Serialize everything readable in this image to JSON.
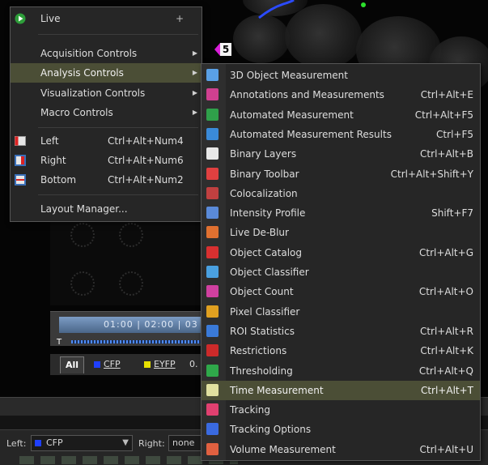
{
  "main_menu": {
    "items": [
      {
        "label": "Live",
        "type": "add",
        "suffix": "+"
      },
      {
        "label": "Acquisition Controls",
        "type": "submenu"
      },
      {
        "label": "Analysis Controls",
        "type": "submenu",
        "highlighted": true
      },
      {
        "label": "Visualization Controls",
        "type": "submenu"
      },
      {
        "label": "Macro Controls",
        "type": "submenu"
      },
      {
        "label": "Left",
        "shortcut": "Ctrl+Alt+Num4"
      },
      {
        "label": "Right",
        "shortcut": "Ctrl+Alt+Num6"
      },
      {
        "label": "Bottom",
        "shortcut": "Ctrl+Alt+Num2"
      },
      {
        "label": "Layout Manager..."
      }
    ]
  },
  "submenu": {
    "items": [
      {
        "label": "3D Object Measurement",
        "shortcut": "",
        "icon": "3d-object-icon"
      },
      {
        "label": "Annotations and Measurements",
        "shortcut": "Ctrl+Alt+E",
        "icon": "annotations-icon"
      },
      {
        "label": "Automated Measurement",
        "shortcut": "Ctrl+Alt+F5",
        "icon": "automated-measurement-icon"
      },
      {
        "label": "Automated Measurement Results",
        "shortcut": "Ctrl+F5",
        "icon": "measurement-results-icon"
      },
      {
        "label": "Binary Layers",
        "shortcut": "Ctrl+Alt+B",
        "icon": "binary-layers-icon"
      },
      {
        "label": "Binary Toolbar",
        "shortcut": "Ctrl+Alt+Shift+Y",
        "icon": "binary-toolbar-icon"
      },
      {
        "label": "Colocalization",
        "shortcut": "",
        "icon": "colocalization-icon"
      },
      {
        "label": "Intensity Profile",
        "shortcut": "Shift+F7",
        "icon": "intensity-profile-icon"
      },
      {
        "label": "Live De-Blur",
        "shortcut": "",
        "icon": "deblur-icon"
      },
      {
        "label": "Object Catalog",
        "shortcut": "Ctrl+Alt+G",
        "icon": "object-catalog-icon"
      },
      {
        "label": "Object Classifier",
        "shortcut": "",
        "icon": "object-classifier-icon"
      },
      {
        "label": "Object Count",
        "shortcut": "Ctrl+Alt+O",
        "icon": "object-count-icon"
      },
      {
        "label": "Pixel Classifier",
        "shortcut": "",
        "icon": "pixel-classifier-icon"
      },
      {
        "label": "ROI Statistics",
        "shortcut": "Ctrl+Alt+R",
        "icon": "roi-statistics-icon"
      },
      {
        "label": "Restrictions",
        "shortcut": "Ctrl+Alt+K",
        "icon": "restrictions-icon"
      },
      {
        "label": "Thresholding",
        "shortcut": "Ctrl+Alt+Q",
        "icon": "thresholding-icon"
      },
      {
        "label": "Time Measurement",
        "shortcut": "Ctrl+Alt+T",
        "icon": "clock-icon",
        "highlighted": true
      },
      {
        "label": "Tracking",
        "shortcut": "",
        "icon": "tracking-icon"
      },
      {
        "label": "Tracking Options",
        "shortcut": "",
        "icon": "tracking-options-icon"
      },
      {
        "label": "Volume Measurement",
        "shortcut": "Ctrl+Alt+U",
        "icon": "volume-icon"
      }
    ]
  },
  "background": {
    "object_tag": "5",
    "timeline_text": "01:00 | 02:00 | 03",
    "t_label": "T",
    "tabs": {
      "all": "All",
      "cfp": "CFP",
      "eyfp": "EYFP",
      "zoom": "0."
    },
    "bottom": {
      "left_label": "Left:",
      "left_value": "CFP",
      "right_label": "Right:",
      "right_value": "none"
    }
  },
  "colors": {
    "highlight": "#4b4e36",
    "cfp": "#1f3fff",
    "eyfp": "#e8e000"
  }
}
